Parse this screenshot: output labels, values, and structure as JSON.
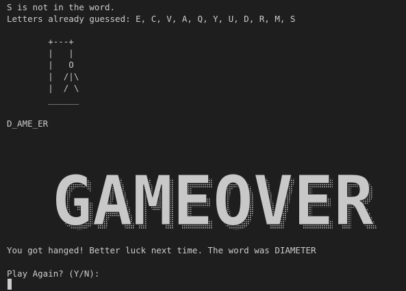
{
  "terminal": {
    "status_line": "S is not in the word.",
    "guessed_line": "Letters already guessed: E, C, V, A, Q, Y, U, D, R, M, S",
    "gallows_art": "        +---+\n        |   |\n        |   O\n        |  /|\\\n        |  / \\\n        ______",
    "word_progress": "D_AME_ER",
    "banner_text": "GAMEOVER",
    "result_line": "You got hanged! Better luck next time. The word was DIAMETER",
    "prompt_line": "Play Again? (Y/N):"
  },
  "colors": {
    "background": "#1e1e1e",
    "foreground": "#cccccc",
    "banner_fill": "#c8c8c8",
    "banner_shadow": "#9a9a9a"
  }
}
